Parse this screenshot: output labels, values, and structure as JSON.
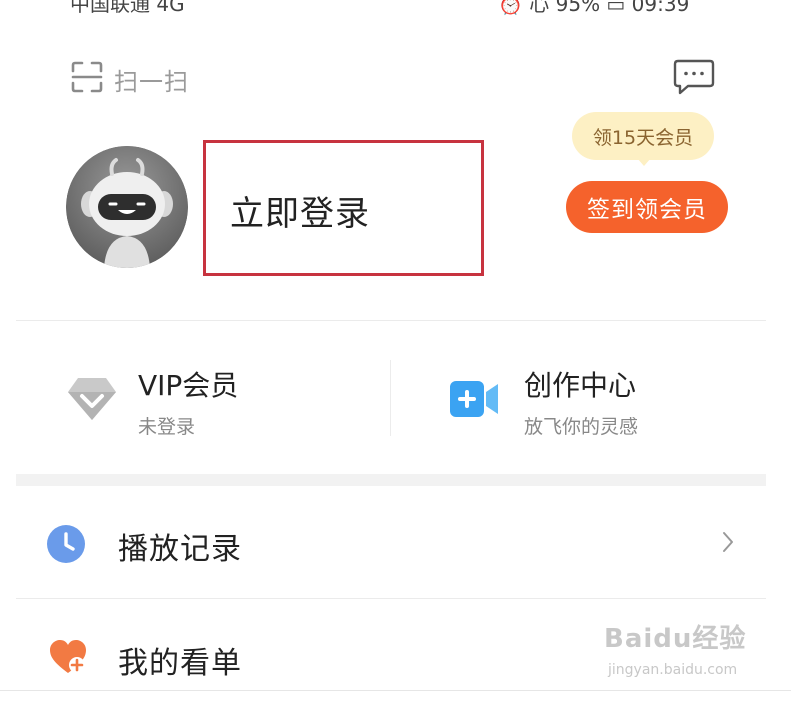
{
  "status_bar": {
    "carrier": "中国联通 4G",
    "right": "⏰ 心 95% ▭ 09:39"
  },
  "header": {
    "scan_label": "扫一扫",
    "scan_icon": "scan-icon",
    "message_icon": "message-icon"
  },
  "profile": {
    "login_label": "立即登录",
    "bubble_text": "领15天会员",
    "checkin_label": "签到领会员",
    "highlight_color": "#c7333f",
    "accent_color": "#f5622c"
  },
  "cards": {
    "vip": {
      "title": "VIP会员",
      "subtitle": "未登录",
      "icon": "diamond-icon"
    },
    "create": {
      "title": "创作中心",
      "subtitle": "放飞你的灵感",
      "icon": "video-camera-icon"
    }
  },
  "list": {
    "history": {
      "label": "播放记录",
      "icon": "clock-icon"
    },
    "watchlist": {
      "label": "我的看单",
      "icon": "heart-plus-icon"
    }
  },
  "watermark": {
    "logo": "Baidu经验",
    "sub": "jingyan.baidu.com"
  }
}
